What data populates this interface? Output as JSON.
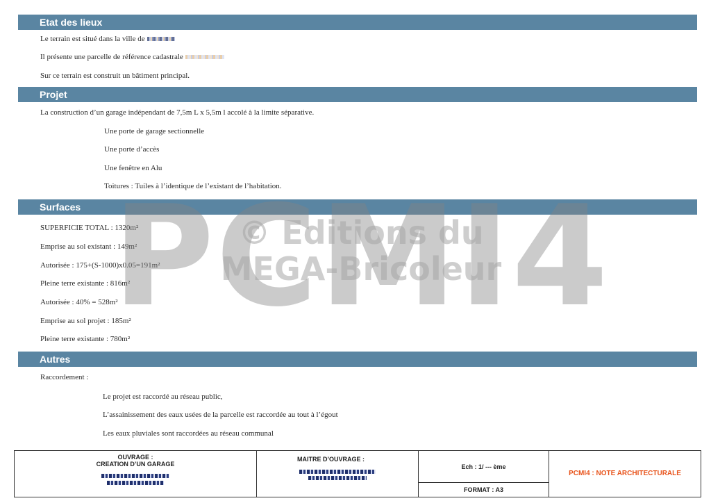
{
  "sections": {
    "etat": {
      "title": "Etat des lieux",
      "line1": "Le terrain est situé dans la ville de",
      "line2": "Il présente une parcelle de référence cadastrale",
      "line3": "Sur ce terrain est construit un bâtiment principal."
    },
    "projet": {
      "title": "Projet",
      "intro": "La construction d’un garage indépendant de 7,5m L x  5,5m l accolé à la limite séparative.",
      "items": [
        "Une porte de garage sectionnelle",
        "Une porte d’accès",
        "Une fenêtre en Alu",
        "Toitures : Tuiles à l’identique de l’existant de l’habitation."
      ]
    },
    "surfaces": {
      "title": "Surfaces",
      "lines": [
        "SUPERFICIE TOTAL : 1320m²",
        "Emprise au sol existant : 149m²",
        "Autorisée : 175+(S-1000)x0.05=191m²",
        "Pleine terre existante : 816m²",
        "Autorisée : 40% = 528m²",
        "Emprise au sol projet : 185m²",
        "Pleine terre existante : 780m²"
      ]
    },
    "autres": {
      "title": "Autres",
      "label": "Raccordement  :",
      "items": [
        "Le projet est raccordé au réseau public,",
        "L’assainissement des eaux usées de la parcelle est raccordée au tout à l’égout",
        "Les eaux pluviales sont raccordées au réseau communal"
      ]
    }
  },
  "watermark": {
    "big": "PCMI4",
    "line1": "© Editions du",
    "line2": "MEGA-Bricoleur"
  },
  "footer": {
    "ouvrage_label": "OUVRAGE :",
    "ouvrage_value": "CREATION D’UN GARAGE",
    "maitre_label": "MAITRE D’OUVRAGE :",
    "echelle": "Ech : 1/ --- ème",
    "format": "FORMAT : A3",
    "doc_title": "PCMI4 : NOTE ARCHITECTURALE",
    "doc_title_color": "#e8541c"
  }
}
